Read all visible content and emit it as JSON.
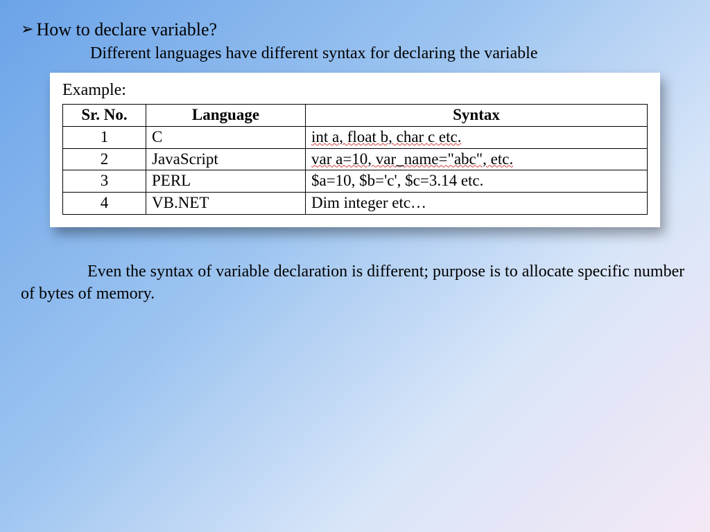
{
  "heading": "How to declare variable?",
  "subtitle": "Different languages have different syntax for declaring the variable",
  "exampleLabel": "Example:",
  "table": {
    "headers": [
      "Sr. No.",
      "Language",
      "Syntax"
    ],
    "rows": [
      {
        "sr": "1",
        "language": "C",
        "syntax_plain": "int a, float b, char c etc.",
        "syntax_squiggle": "int"
      },
      {
        "sr": "2",
        "language": "JavaScript",
        "syntax_plain": "var a=10, var_name=\"abc\", etc.",
        "syntax_squiggle": "var"
      },
      {
        "sr": "3",
        "language": "PERL",
        "syntax_plain": "$a=10, $b='c', $c=3.14 etc.",
        "syntax_squiggle": ""
      },
      {
        "sr": "4",
        "language": "VB.NET",
        "syntax_plain": "Dim integer etc…",
        "syntax_squiggle": ""
      }
    ]
  },
  "footer": "Even the syntax of variable declaration is different; purpose is to allocate specific number of bytes of memory."
}
